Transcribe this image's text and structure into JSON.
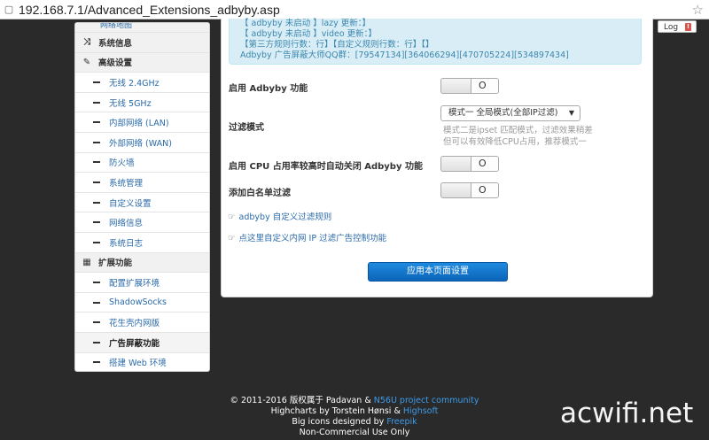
{
  "browser": {
    "url": "192.168.7.1/Advanced_Extensions_adbyby.asp"
  },
  "sidebar": {
    "top_partial": "网络地图",
    "items": [
      {
        "type": "head",
        "label": "系统信息",
        "icon": "shuffle-icon"
      },
      {
        "type": "head",
        "label": "高级设置",
        "icon": "wrench-icon"
      },
      {
        "type": "sub",
        "label": "无线 2.4GHz"
      },
      {
        "type": "sub",
        "label": "无线 5GHz"
      },
      {
        "type": "sub",
        "label": "内部网络 (LAN)"
      },
      {
        "type": "sub",
        "label": "外部网络 (WAN)"
      },
      {
        "type": "sub",
        "label": "防火墙"
      },
      {
        "type": "sub",
        "label": "系统管理"
      },
      {
        "type": "sub",
        "label": "自定义设置"
      },
      {
        "type": "sub",
        "label": "网络信息"
      },
      {
        "type": "sub",
        "label": "系统日志"
      },
      {
        "type": "head",
        "label": "扩展功能",
        "icon": "grid-icon"
      },
      {
        "type": "sub",
        "label": "配置扩展环境"
      },
      {
        "type": "sub",
        "label": "ShadowSocks"
      },
      {
        "type": "sub",
        "label": "花生壳内网版"
      },
      {
        "type": "sub",
        "label": "广告屏蔽功能",
        "active": true
      },
      {
        "type": "sub",
        "label": "搭建 Web 环境"
      }
    ]
  },
  "info": {
    "line1": "【 adbyby 未启动 】lazy 更新：】",
    "line2": "【 adbyby 未启动 】video 更新：】",
    "line3": "【第三方规则行数：行】【自定义规则行数：行】【】",
    "line4": "Adbyby 广告屏蔽大师QQ群：[79547134][364066294][470705224][534897434]"
  },
  "form": {
    "enable_label": "启用 Adbyby 功能",
    "filter_mode_label": "过滤模式",
    "filter_mode_value": "模式一 全局模式(全部IP过滤)",
    "filter_hint1": "模式二是ipset 匹配模式，过滤效果稍差",
    "filter_hint2": "但可以有效降低CPU占用，推荐模式一",
    "cpu_label": "启用 CPU 占用率较高时自动关闭 Adbyby 功能",
    "whitelist_label": "添加白名单过滤",
    "toggle_symbol": "O",
    "link1": "adbyby 自定义过滤规则",
    "link2": "点这里自定义内网 IP 过滤广告控制功能",
    "apply_label": "应用本页面设置"
  },
  "log_button": "Log",
  "log_badge": "!",
  "footer": {
    "line1_pre": "© 2011-2016 版权属于 Padavan & ",
    "line1_link": "N56U project community",
    "line2_pre": "Highcharts by Torstein Hønsi & ",
    "line2_link": "Highsoft",
    "line3_pre": "Big icons designed by ",
    "line3_link": "Freepik",
    "line4": "Non-Commercial Use Only"
  },
  "watermark": "acwifi.net"
}
